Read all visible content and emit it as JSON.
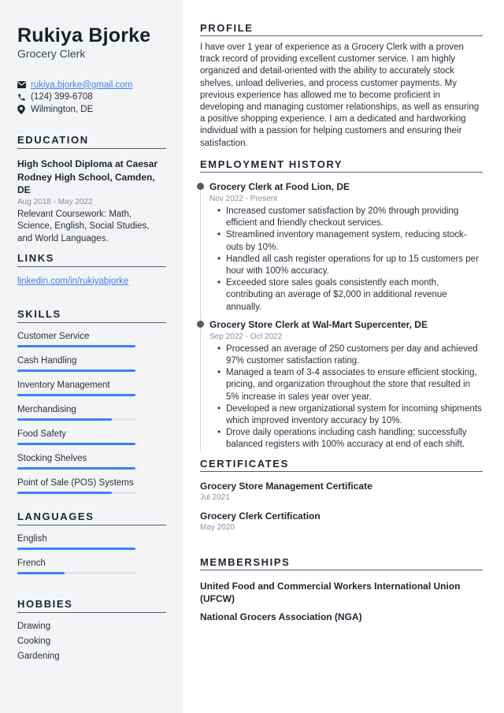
{
  "header": {
    "name": "Rukiya Bjorke",
    "title": "Grocery Clerk",
    "contacts": [
      {
        "icon": "envelope-icon",
        "text": "rukiya.bjorke@gmail.com",
        "link": true
      },
      {
        "icon": "phone-icon",
        "text": "(124) 399-6708",
        "link": false
      },
      {
        "icon": "location-pin-icon",
        "text": "Wilmington, DE",
        "link": false
      }
    ]
  },
  "education": {
    "heading": "EDUCATION",
    "title": "High School Diploma at Caesar Rodney High School, Camden, DE",
    "date": "Aug 2018 - May 2022",
    "description": "Relevant Coursework: Math, Science, English, Social Studies, and World Languages."
  },
  "links": {
    "heading": "LINKS",
    "items": [
      "linkedin.com/in/rukiyabjorke"
    ]
  },
  "skills": {
    "heading": "SKILLS",
    "accent_color": "#3b82f6",
    "items": [
      {
        "label": "Customer Service",
        "level": 1.0
      },
      {
        "label": "Cash Handling",
        "level": 1.0
      },
      {
        "label": "Inventory Management",
        "level": 1.0
      },
      {
        "label": "Merchandising",
        "level": 0.8
      },
      {
        "label": "Food Safety",
        "level": 1.0
      },
      {
        "label": "Stocking Shelves",
        "level": 1.0
      },
      {
        "label": "Point of Sale (POS) Systems",
        "level": 0.8
      }
    ]
  },
  "languages": {
    "heading": "LANGUAGES",
    "items": [
      {
        "label": "English",
        "level": 1.0
      },
      {
        "label": "French",
        "level": 0.4
      }
    ]
  },
  "hobbies": {
    "heading": "HOBBIES",
    "items": [
      "Drawing",
      "Cooking",
      "Gardening"
    ]
  },
  "profile": {
    "heading": "PROFILE",
    "text": "I have over 1 year of experience as a Grocery Clerk with a proven track record of providing excellent customer service. I am highly organized and detail-oriented with the ability to accurately stock shelves, unload deliveries, and process customer payments. My previous experience has allowed me to become proficient in developing and managing customer relationships, as well as ensuring a positive shopping experience. I am a dedicated and hardworking individual with a passion for helping customers and ensuring their satisfaction."
  },
  "employment": {
    "heading": "EMPLOYMENT HISTORY",
    "jobs": [
      {
        "title": "Grocery Clerk at Food Lion, DE",
        "date": "Nov 2022 - Present",
        "bullets": [
          "Increased customer satisfaction by 20% through providing efficient and friendly checkout services.",
          "Streamlined inventory management system, reducing stock-outs by 10%.",
          "Handled all cash register operations for up to 15 customers per hour with 100% accuracy.",
          "Exceeded store sales goals consistently each month, contributing an average of $2,000 in additional revenue annually."
        ]
      },
      {
        "title": "Grocery Store Clerk at Wal-Mart Supercenter, DE",
        "date": "Sep 2022 - Oct 2022",
        "bullets": [
          "Processed an average of 250 customers per day and achieved 97% customer satisfaction rating.",
          "Managed a team of 3-4 associates to ensure efficient stocking, pricing, and organization throughout the store that resulted in 5% increase in sales year over year.",
          "Developed a new organizational system for incoming shipments which improved inventory accuracy by 10%.",
          "Drove daily operations including cash handling; successfully balanced registers with 100% accuracy at end of each shift."
        ]
      }
    ]
  },
  "certificates": {
    "heading": "CERTIFICATES",
    "items": [
      {
        "title": "Grocery Store Management Certificate",
        "date": "Jul 2021"
      },
      {
        "title": "Grocery Clerk Certification",
        "date": "May 2020"
      }
    ]
  },
  "memberships": {
    "heading": "MEMBERSHIPS",
    "items": [
      "United Food and Commercial Workers International Union (UFCW)",
      "National Grocers Association (NGA)"
    ]
  }
}
